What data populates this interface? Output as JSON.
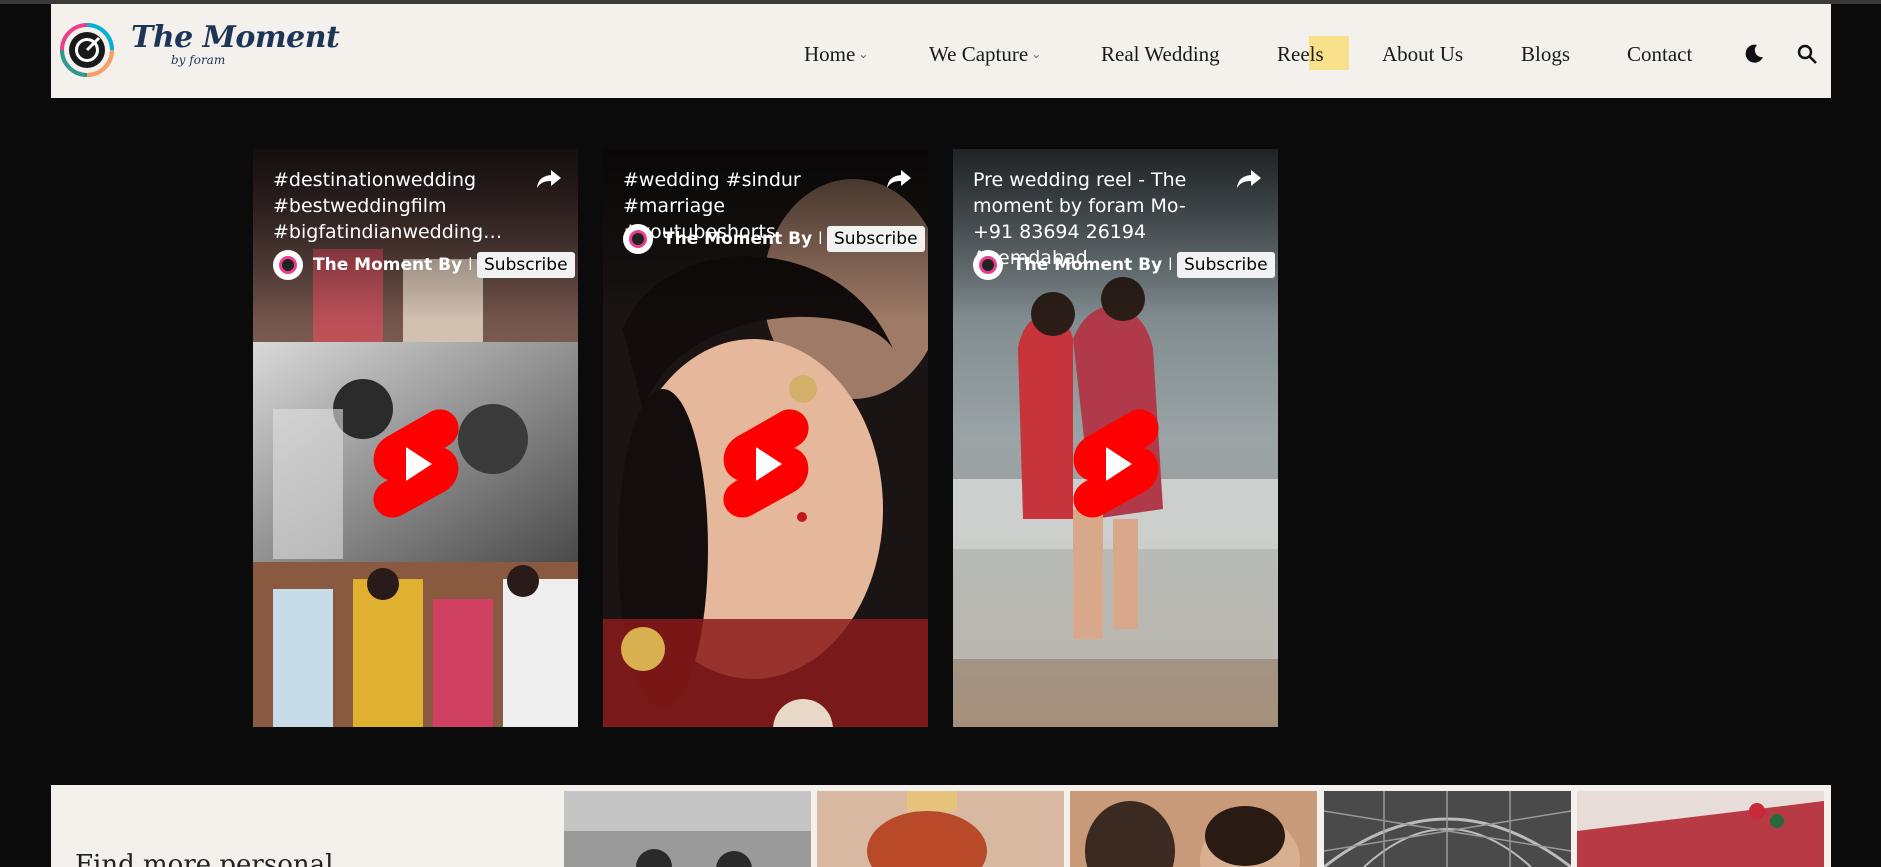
{
  "brand": {
    "title": "The Moment",
    "subtitle": "by foram"
  },
  "nav": {
    "items": [
      {
        "label": "Home",
        "dropdown": true
      },
      {
        "label": "We Capture",
        "dropdown": true
      },
      {
        "label": "Real Wedding",
        "dropdown": false
      },
      {
        "label": "Reels",
        "dropdown": false,
        "active": true
      },
      {
        "label": "About Us",
        "dropdown": false
      },
      {
        "label": "Blogs",
        "dropdown": false
      },
      {
        "label": "Contact",
        "dropdown": false
      }
    ],
    "theme_toggle_icon": "moon-icon",
    "search_icon": "search-icon",
    "active_highlight_color": "#f9e08a"
  },
  "shorts": [
    {
      "title": "#destinationwedding #bestweddingfilm #bigfatindianwedding…",
      "channel": "The Moment By F…",
      "subscribe": "Subscribe"
    },
    {
      "title": "#wedding #sindur #marriage #youtubeshorts",
      "channel": "The Moment By F…",
      "subscribe": "Subscribe"
    },
    {
      "title": "Pre wedding reel - The moment by foram Mo- +91 83694 26194 Ahemdabad",
      "channel": "The Moment By F…",
      "subscribe": "Subscribe"
    }
  ],
  "bottom": {
    "heading": "Find more personal"
  },
  "colors": {
    "page_bg": "#0b0b0b",
    "header_bg": "#f4f1ec",
    "play_red": "#ff0000",
    "brand_blue": "#1d3557"
  }
}
